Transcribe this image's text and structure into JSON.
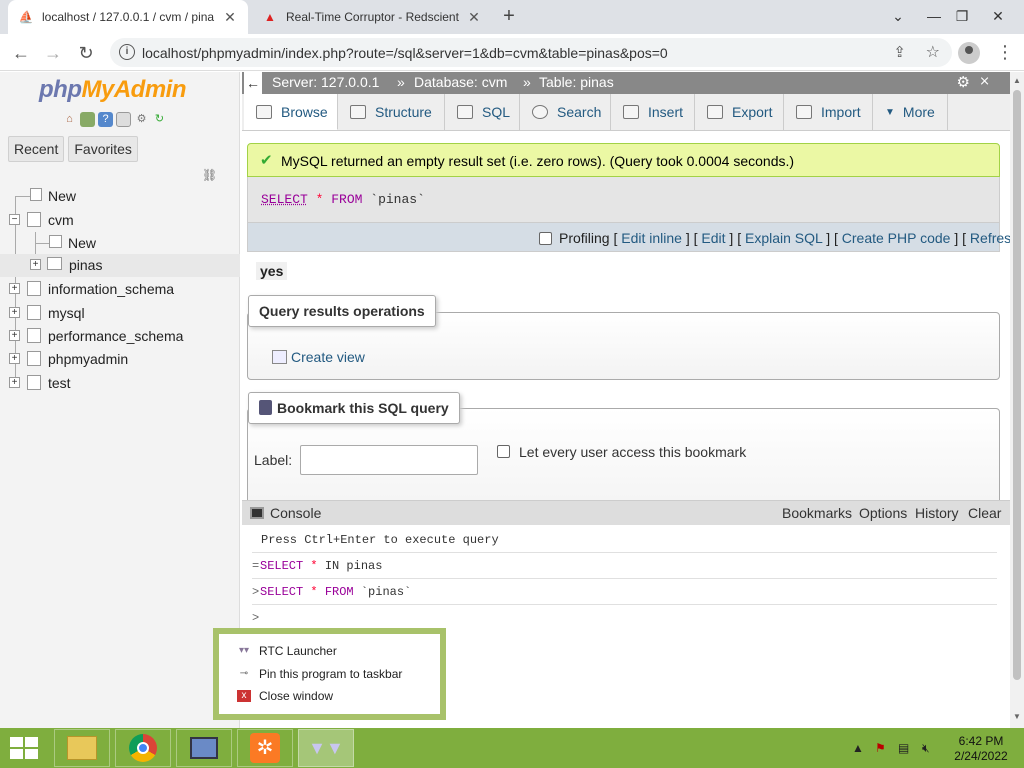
{
  "browser": {
    "tabs": [
      {
        "title": "localhost / 127.0.0.1 / cvm / pina",
        "active": true
      },
      {
        "title": "Real-Time Corruptor - Redscient",
        "active": false
      }
    ],
    "url": "localhost/phpmyadmin/index.php?route=/sql&server=1&db=cvm&table=pinas&pos=0"
  },
  "logo": {
    "part1": "php",
    "part2": "MyAdmin"
  },
  "navtabs": {
    "recent": "Recent",
    "favorites": "Favorites"
  },
  "tree": {
    "new_top": "New",
    "cvm": "cvm",
    "new_cvm": "New",
    "pinas": "pinas",
    "information_schema": "information_schema",
    "mysql": "mysql",
    "performance_schema": "performance_schema",
    "phpmyadmin": "phpmyadmin",
    "test": "test"
  },
  "breadcrumb": {
    "server": "Server: 127.0.0.1",
    "database": "Database: cvm",
    "table": "Table: pinas",
    "sep": "»"
  },
  "menu": {
    "browse": "Browse",
    "structure": "Structure",
    "sql": "SQL",
    "search": "Search",
    "insert": "Insert",
    "export": "Export",
    "import": "Import",
    "more": "More"
  },
  "result": {
    "message": "MySQL returned an empty result set (i.e. zero rows). (Query took 0.0004 seconds.)",
    "query_kw": "SELECT",
    "query_op": "*",
    "query_from": "FROM",
    "query_table": "`pinas`"
  },
  "actions": {
    "profiling": "Profiling",
    "edit_inline": "Edit inline",
    "edit": "Edit",
    "explain": "Explain SQL",
    "create_php": "Create PHP code",
    "refresh": "Refresh"
  },
  "yes_label": "yes",
  "query_ops": {
    "legend": "Query results operations",
    "create_view": "Create view"
  },
  "bookmark": {
    "legend": "Bookmark this SQL query",
    "label": "Label:",
    "label_value": "",
    "share_label": "Let every user access this bookmark"
  },
  "console": {
    "title": "Console",
    "bookmarks": "Bookmarks",
    "options": "Options",
    "history": "History",
    "clear": "Clear",
    "hint": "Press Ctrl+Enter to execute query",
    "line1_kw": "SELECT",
    "line1_op": "*",
    "line1_rest": "IN pinas",
    "line2_kw": "SELECT",
    "line2_op": "*",
    "line2_from": "FROM",
    "line2_table": "`pinas`",
    "prompt": ">"
  },
  "jumplist": {
    "app": "RTC Launcher",
    "pin": "Pin this program to taskbar",
    "close": "Close window"
  },
  "clock": {
    "time": "6:42 PM",
    "date": "2/24/2022"
  },
  "colors": {
    "taskbar": "#7fae3e",
    "link": "#235a81",
    "success_bg": "#ebf8a4"
  }
}
